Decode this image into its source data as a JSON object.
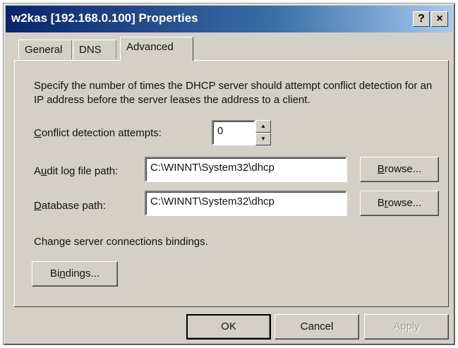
{
  "window": {
    "title": "w2kas [192.168.0.100] Properties",
    "help_glyph": "?",
    "close_glyph": "×"
  },
  "tabs": [
    {
      "label": "General"
    },
    {
      "label": "DNS"
    },
    {
      "label": "Advanced"
    }
  ],
  "advanced": {
    "description": "Specify the number of times the DHCP server should attempt conflict detection for an IP address before the server leases the address to a client.",
    "conflict_label_mnemonic": "C",
    "conflict_label_rest": "onflict detection attempts:",
    "conflict_value": "0",
    "audit_label_pre": "A",
    "audit_label_mnemonic": "u",
    "audit_label_rest": "dit log file path:",
    "audit_value": "C:\\WINNT\\System32\\dhcp",
    "audit_browse_mnemonic": "B",
    "audit_browse_rest": "rowse...",
    "database_label_mnemonic": "D",
    "database_label_rest": "atabase path:",
    "database_value": "C:\\WINNT\\System32\\dhcp",
    "database_browse_pre": "B",
    "database_browse_mnemonic": "r",
    "database_browse_rest": "owse...",
    "bindings_text": "Change server connections bindings.",
    "bindings_button_pre": "Bi",
    "bindings_button_mnemonic": "n",
    "bindings_button_rest": "dings..."
  },
  "buttons": {
    "ok": "OK",
    "cancel": "Cancel",
    "apply": "Apply"
  }
}
